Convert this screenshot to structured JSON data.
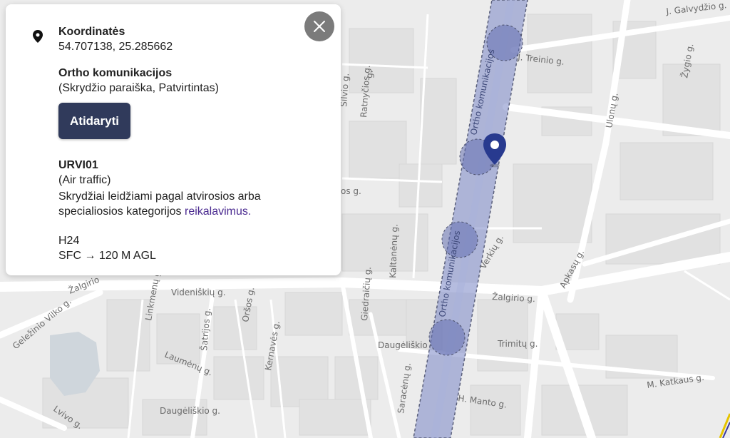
{
  "popup": {
    "coordinates_title": "Koordinatės",
    "coordinates_value": "54.707138, 25.285662",
    "zone_name": "Ortho komunikacijos",
    "zone_status": "(Skrydžio paraiška, Patvirtintas)",
    "open_button": "Atidaryti",
    "area_code": "URVI01",
    "area_type": "(Air traffic)",
    "area_desc_text": "Skrydžiai leidžiami pagal atvirosios arba specialiosios kategorijos ",
    "area_desc_link": "reikalavimus.",
    "schedule": "H24",
    "altitude": "SFC → 120 M AGL"
  },
  "map": {
    "zone_label": "Ortho komunikacijos",
    "streets": {
      "galvydzio": "J. Galvydžio g.",
      "treinio": "J. Treinio g.",
      "zygio": "Žygio g.",
      "ulonu": "Ulonų g.",
      "apkasu": "Apkasų g.",
      "verkiu": "Verkių g.",
      "zalgirio_right": "Žalgirio g.",
      "zalgirio_left": "Žalgirio",
      "videniskiu": "Videniškių g.",
      "trimitu": "Trimitų g.",
      "daugeliskio_right": "Daugėliškio",
      "daugeliskio_left": "Daugėliškio g.",
      "katkaus": "M. Katkaus g.",
      "manto": "H. Manto g.",
      "saraceny": "Saracėnų g.",
      "kernaves": "Kernavės g.",
      "orsos": "Oršos g.",
      "satrijos": "Šatrijos g.",
      "laumenu": "Laumėnų g.",
      "linkmenu": "Linkmenų g.",
      "gelezinio": "Geležinio Vilko g.",
      "lvivo": "Lvivo g.",
      "kaltanenu": "Kaltanėnų g.",
      "giedraiciu": "Giedraičių g.",
      "ratnycios": "Ratnyčios g.",
      "silvio": "Šilvio g.",
      "g_label": "g.",
      "os_g": "os g."
    }
  },
  "colors": {
    "zone_fill": "#8390c9",
    "zone_circle": "#6470b0",
    "button_bg": "#303a5b",
    "pin": "#283a8f",
    "link": "#4a2a90"
  },
  "icons": {
    "close": "close-icon",
    "location": "location-pin-icon",
    "map_marker": "map-marker-icon"
  }
}
